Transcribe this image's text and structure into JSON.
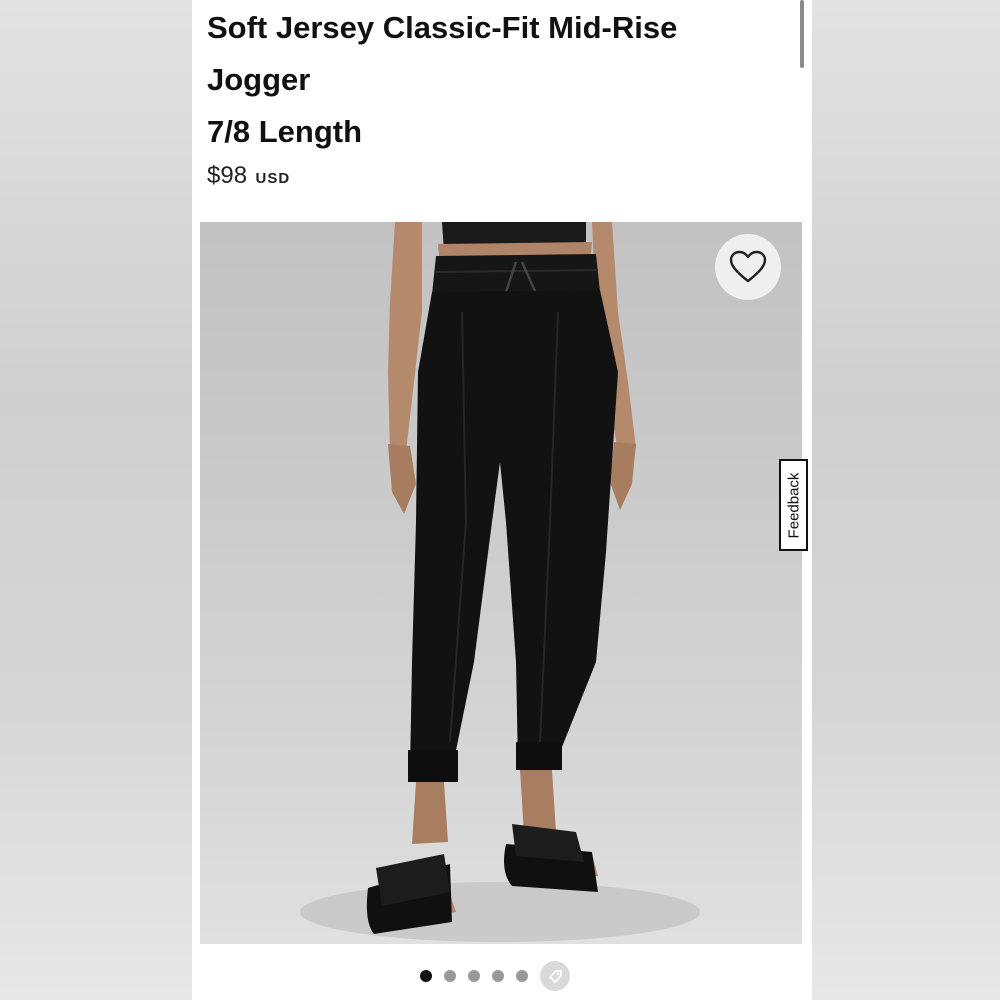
{
  "product": {
    "title_lines": [
      "Soft Jersey Classic-Fit Mid-Rise",
      "Jogger",
      "7/8 Length"
    ],
    "price": "$98",
    "currency": "USD"
  },
  "gallery": {
    "image_subject": "black jogger pants worn by model with black slide sandals",
    "wishlist_icon": "heart-outline-icon",
    "slide_count": 5,
    "active_slide": 1,
    "extra_indicator_icon": "360-view-icon"
  },
  "feedback": {
    "label": "Feedback"
  },
  "colors": {
    "text": "#111111",
    "pants": "#121212",
    "background": "#ffffff"
  }
}
